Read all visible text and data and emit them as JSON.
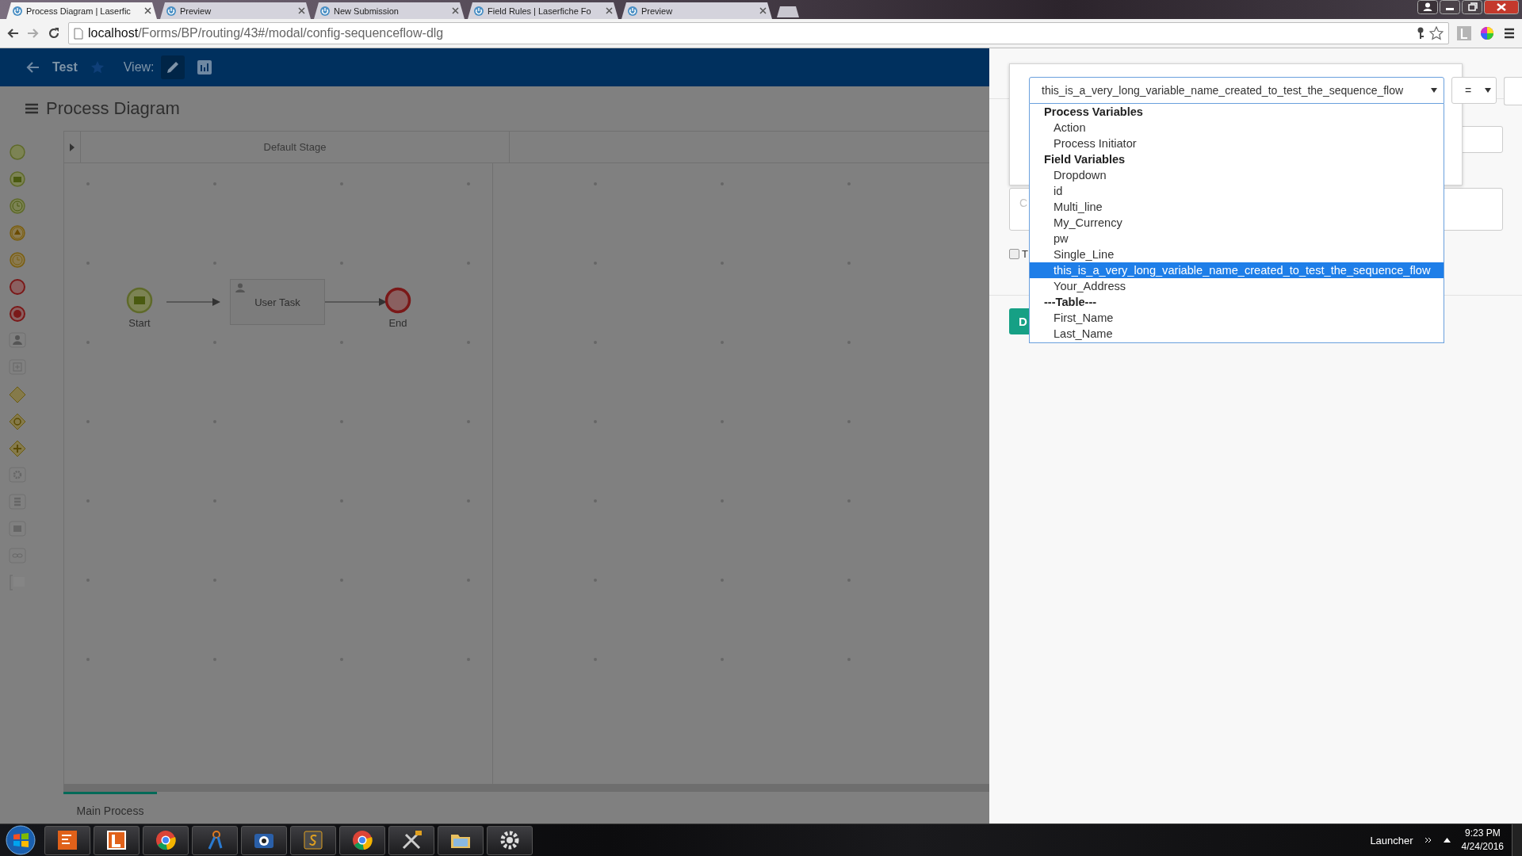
{
  "browser": {
    "tabs": [
      {
        "title": "Process Diagram | Laserfic",
        "selected": true
      },
      {
        "title": "Preview",
        "selected": false
      },
      {
        "title": "New Submission",
        "selected": false
      },
      {
        "title": "Field Rules | Laserfiche Fo",
        "selected": false
      },
      {
        "title": "Preview",
        "selected": false
      }
    ],
    "address": {
      "host": "localhost",
      "path": "/Forms/BP/routing/43#/modal/config-sequenceflow-dlg"
    }
  },
  "app_header": {
    "title": "Test",
    "view_label": "View:"
  },
  "page_title": "Process Diagram",
  "diagram": {
    "stage": "Default Stage",
    "nodes": [
      {
        "kind": "start",
        "label": "Start"
      },
      {
        "kind": "task",
        "label": "User Task"
      },
      {
        "kind": "end",
        "label": "End"
      }
    ]
  },
  "process_tabs": [
    {
      "label": "Main Process",
      "selected": true
    }
  ],
  "condition": {
    "variable": {
      "value": "this_is_a_very_long_variable_name_created_to_test_the_sequence_flow",
      "expanded": true
    },
    "operator": "=",
    "options": [
      {
        "kind": "group",
        "label": "Process Variables",
        "selected": false
      },
      {
        "kind": "option",
        "label": "Action",
        "selected": false
      },
      {
        "kind": "option",
        "label": "Process Initiator",
        "selected": false
      },
      {
        "kind": "group",
        "label": "Field Variables",
        "selected": false
      },
      {
        "kind": "option",
        "label": "Dropdown",
        "selected": false
      },
      {
        "kind": "option",
        "label": "id",
        "selected": false
      },
      {
        "kind": "option",
        "label": "Multi_line",
        "selected": false
      },
      {
        "kind": "option",
        "label": "My_Currency",
        "selected": false
      },
      {
        "kind": "option",
        "label": "pw",
        "selected": false
      },
      {
        "kind": "option",
        "label": "Single_Line",
        "selected": false
      },
      {
        "kind": "option",
        "label": "this_is_a_very_long_variable_name_created_to_test_the_sequence_flow",
        "selected": true
      },
      {
        "kind": "option",
        "label": "Your_Address",
        "selected": false
      },
      {
        "kind": "group",
        "label": "---Table---",
        "selected": false
      },
      {
        "kind": "option",
        "label": "First_Name",
        "selected": false
      },
      {
        "kind": "option",
        "label": "Last_Name",
        "selected": false
      }
    ],
    "comment_placeholder": "C",
    "checkbox": {
      "label": "T",
      "checked": false
    },
    "button": "D"
  },
  "taskbar": {
    "tray_label": "Launcher",
    "time": "9:23 PM",
    "date": "4/24/2016"
  }
}
